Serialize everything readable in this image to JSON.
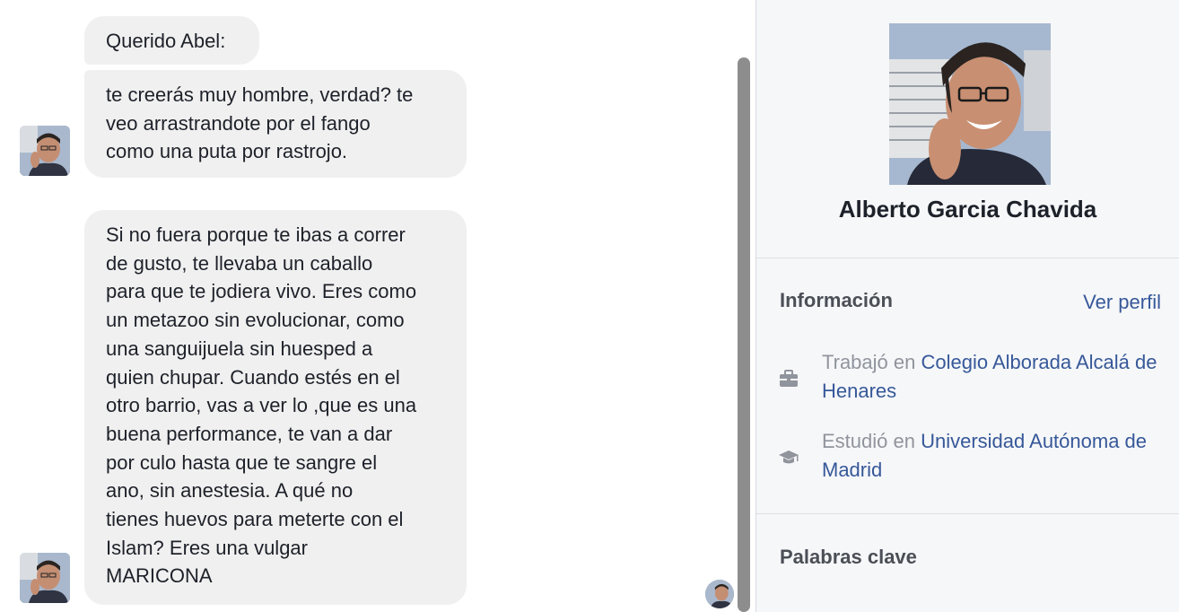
{
  "chat": {
    "messages": [
      {
        "text": "Querido Abel:"
      },
      {
        "text": "te creerás muy hombre, verdad? te\nveo arrastrandote por el fango\ncomo una puta por rastrojo."
      },
      {
        "text": "Si no fuera porque te ibas a correr\nde gusto, te llevaba un caballo\npara que te jodiera vivo. Eres como\nun metazoo sin evolucionar, como\nuna sanguijuela sin huesped a\nquien chupar. Cuando estés en el\notro barrio, vas a ver lo ,que es una\nbuena performance, te van a dar\npor culo hasta que te sangre el\nano, sin anestesia.   A qué no\ntienes huevos para meterte con el\nIslam? Eres una vulgar\nMARICONA"
      }
    ]
  },
  "profile": {
    "name": "Alberto Garcia Chavida"
  },
  "info": {
    "title": "Información",
    "view_profile": "Ver perfil",
    "work_prefix": "Trabajó en ",
    "work_place": "Colegio Alborada Alcalá de Henares",
    "study_prefix": "Estudió en ",
    "study_place": "Universidad Autónoma de Madrid",
    "work_icon": "briefcase-icon",
    "study_icon": "graduation-cap-icon"
  },
  "keywords": {
    "title": "Palabras clave"
  },
  "colors": {
    "bubble": "#f1f0f0",
    "link": "#365899",
    "panel_bg": "#f6f7f9"
  }
}
